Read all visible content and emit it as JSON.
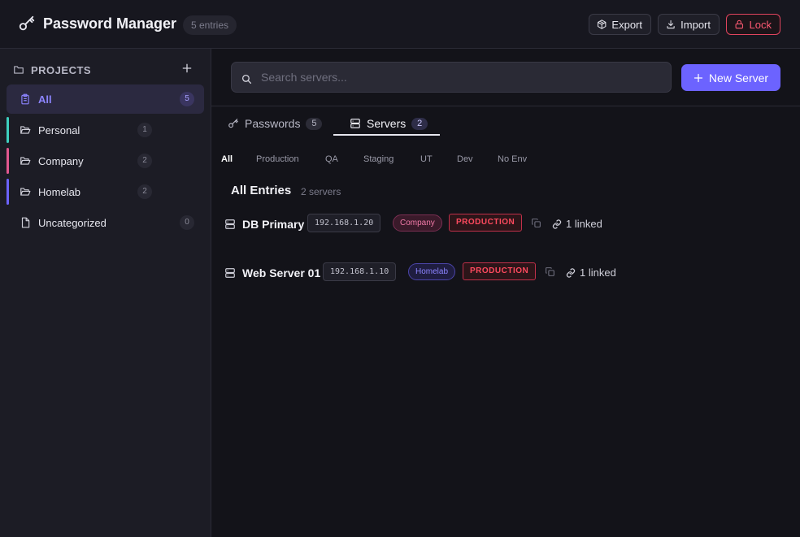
{
  "header": {
    "title": "Password Manager",
    "entries_badge": "5 entries",
    "export_label": "Export",
    "import_label": "Import",
    "lock_label": "Lock"
  },
  "sidebar": {
    "projects_title": "PROJECTS",
    "items": [
      {
        "label": "All",
        "count": "5"
      },
      {
        "label": "Personal",
        "count": "1",
        "accent": "#3ecfbf"
      },
      {
        "label": "Company",
        "count": "2",
        "accent": "#e2578f"
      },
      {
        "label": "Homelab",
        "count": "2",
        "accent": "#6c63ff"
      },
      {
        "label": "Uncategorized",
        "count": "0"
      }
    ]
  },
  "search": {
    "placeholder": "Search servers..."
  },
  "new_server_label": "New Server",
  "tabs": [
    {
      "label": "Passwords",
      "count": "5"
    },
    {
      "label": "Servers",
      "count": "2"
    }
  ],
  "env_filters": [
    "All",
    "Production",
    "QA",
    "Staging",
    "UT",
    "Dev",
    "No Env"
  ],
  "section": {
    "title": "All Entries",
    "count": "2 servers"
  },
  "servers": [
    {
      "name": "DB Primary",
      "ip": "192.168.1.20",
      "project": "Company",
      "env": "PRODUCTION",
      "linked": "1 linked"
    },
    {
      "name": "Web Server 01",
      "ip": "192.168.1.10",
      "project": "Homelab",
      "env": "PRODUCTION",
      "linked": "1 linked"
    }
  ],
  "colors": {
    "accent": "#6c63ff",
    "danger": "#ff4a5e",
    "company": "#e2578f",
    "homelab": "#6c63ff",
    "personal": "#3ecfbf"
  }
}
